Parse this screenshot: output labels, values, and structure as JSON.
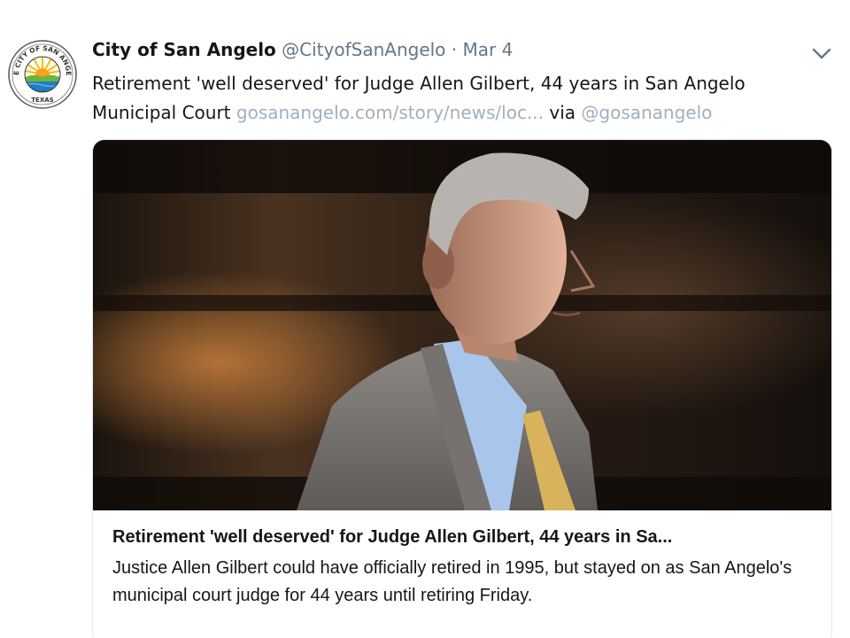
{
  "tweet": {
    "display_name": "City of San Angelo",
    "handle": "@CityofSanAngelo",
    "separator": "·",
    "date": "Mar 4",
    "text_before": "Retirement 'well deserved' for Judge Allen Gilbert, 44 years in San Angelo Municipal Court ",
    "link": "gosanangelo.com/story/news/loc...",
    "via_text": " via ",
    "via_handle": "@gosanangelo",
    "avatar": {
      "icon": "city-seal-icon",
      "ring_text": "THE CITY OF SAN ANGELO",
      "bottom_text": "TEXAS"
    }
  },
  "card": {
    "title": "Retirement 'well deserved' for Judge Allen Gilbert, 44 years in Sa...",
    "description": "Justice Allen Gilbert could have officially retired in 1995, but stayed on as San Angelo's municipal court judge for 44 years until retiring Friday."
  },
  "colors": {
    "text": "#14171a",
    "muted": "#657786",
    "link_faded": "#9fb0bd",
    "border": "#e1e8ed"
  }
}
